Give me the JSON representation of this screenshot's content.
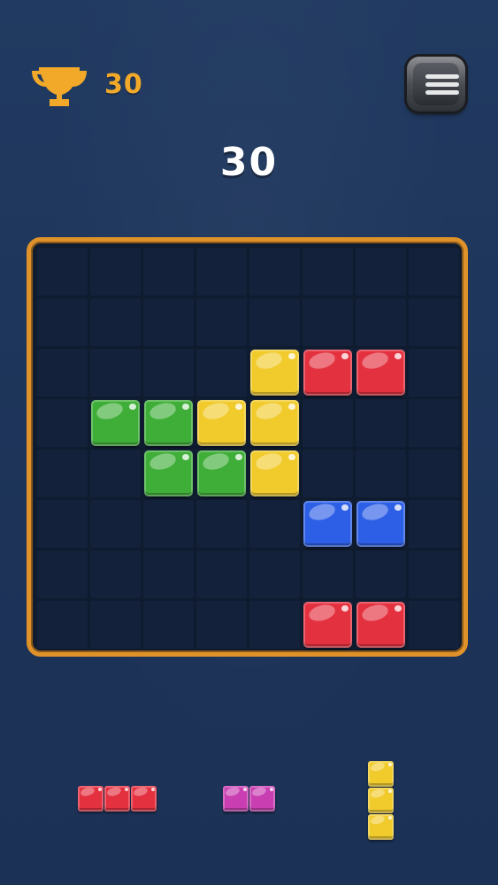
{
  "hud": {
    "best_score": "30",
    "trophy_icon": "trophy-icon",
    "menu_icon": "menu-icon"
  },
  "score": "30",
  "colors": {
    "red": "#e4313f",
    "yellow": "#f1cb2c",
    "green": "#3fae38",
    "blue": "#2d5fe6",
    "magenta": "#c93fb2",
    "accent_gold": "#f2a92a",
    "frame_orange": "#e0922a"
  },
  "board": {
    "cols": 8,
    "rows": 8,
    "placed": [
      {
        "row": 2,
        "col": 4,
        "color": "yellow"
      },
      {
        "row": 2,
        "col": 5,
        "color": "red"
      },
      {
        "row": 2,
        "col": 6,
        "color": "red"
      },
      {
        "row": 3,
        "col": 1,
        "color": "green"
      },
      {
        "row": 3,
        "col": 2,
        "color": "green"
      },
      {
        "row": 3,
        "col": 3,
        "color": "yellow"
      },
      {
        "row": 3,
        "col": 4,
        "color": "yellow"
      },
      {
        "row": 4,
        "col": 2,
        "color": "green"
      },
      {
        "row": 4,
        "col": 3,
        "color": "green"
      },
      {
        "row": 4,
        "col": 4,
        "color": "yellow"
      },
      {
        "row": 5,
        "col": 5,
        "color": "blue"
      },
      {
        "row": 5,
        "col": 6,
        "color": "blue"
      },
      {
        "row": 7,
        "col": 5,
        "color": "red"
      },
      {
        "row": 7,
        "col": 6,
        "color": "red"
      }
    ]
  },
  "tray": [
    {
      "name": "piece-red-horizontal-3",
      "color": "red",
      "cells": [
        [
          0,
          0
        ],
        [
          0,
          1
        ],
        [
          0,
          2
        ]
      ]
    },
    {
      "name": "piece-magenta-horizontal-2",
      "color": "magenta",
      "cells": [
        [
          0,
          0
        ],
        [
          0,
          1
        ]
      ]
    },
    {
      "name": "piece-yellow-vertical-3",
      "color": "yellow",
      "cells": [
        [
          0,
          0
        ],
        [
          1,
          0
        ],
        [
          2,
          0
        ]
      ]
    }
  ]
}
